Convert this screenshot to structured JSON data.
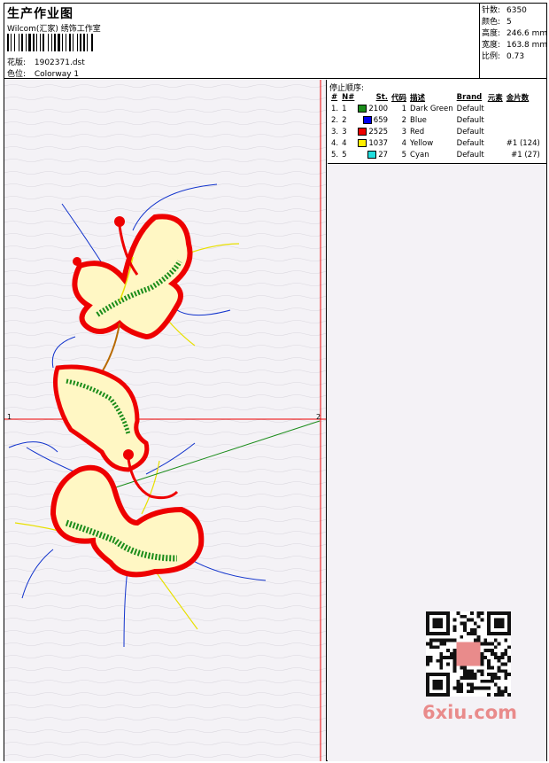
{
  "header": {
    "title": "生产作业图",
    "company": "Wilcom(汇家) 绣饰工作室",
    "design_label": "花版:",
    "design_value": "1902371.dst",
    "colorway_label": "色位:",
    "colorway_value": "Colorway 1"
  },
  "specs": [
    {
      "label": "针数:",
      "value": "6350"
    },
    {
      "label": "颜色:",
      "value": "5"
    },
    {
      "label": "高度:",
      "value": "246.6 mm"
    },
    {
      "label": "宽度:",
      "value": "163.8 mm"
    },
    {
      "label": "比例:",
      "value": "0.73"
    }
  ],
  "stop_sequence": {
    "title": "停止顺序:",
    "columns": [
      "#",
      "N#",
      "St.",
      "代码",
      "描述",
      "Brand",
      "元素",
      "金片数"
    ],
    "rows": [
      {
        "num": "1.",
        "n": "1",
        "color": "#1a8c1a",
        "st": "2100",
        "code": "1",
        "desc": "Dark Green",
        "brand": "Default",
        "elem": "",
        "seq": ""
      },
      {
        "num": "2.",
        "n": "2",
        "color": "#0000ee",
        "st": "659",
        "code": "2",
        "desc": "Blue",
        "brand": "Default",
        "elem": "",
        "seq": ""
      },
      {
        "num": "3.",
        "n": "3",
        "color": "#ee0000",
        "st": "2525",
        "code": "3",
        "desc": "Red",
        "brand": "Default",
        "elem": "",
        "seq": ""
      },
      {
        "num": "4.",
        "n": "4",
        "color": "#ffee00",
        "st": "1037",
        "code": "4",
        "desc": "Yellow",
        "brand": "Default",
        "elem": "",
        "seq": "#1 (124)"
      },
      {
        "num": "5.",
        "n": "5",
        "color": "#22dddd",
        "st": "27",
        "code": "5",
        "desc": "Cyan",
        "brand": "Default",
        "elem": "",
        "seq": "#1 (27)"
      }
    ]
  },
  "canvas": {
    "marker_left": "1",
    "marker_right": "2"
  },
  "watermark": "6xiu.com"
}
